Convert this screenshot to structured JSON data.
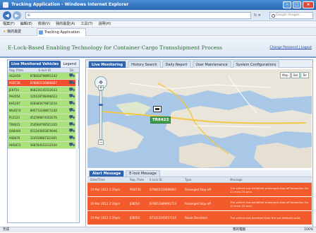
{
  "window": {
    "title": "Tracking Application - Windows Internet Explorer"
  },
  "addressbar": {
    "search_placeholder": "Google Images"
  },
  "menubar": {
    "items": [
      "檔案(F)",
      "編輯(E)",
      "檢視(V)",
      "我的最愛(A)",
      "工具(T)",
      "說明(H)"
    ]
  },
  "tabbar": {
    "favorites": "我的最愛",
    "tab_label": "Tracking Application"
  },
  "header": {
    "title": "E-Lock-Based Enabling Technology for Container Cargo Transshipment Process",
    "links": "Change Password | Logout"
  },
  "vehicles": {
    "tab": "Live Monitored Vehicles",
    "legend": "Legend",
    "columns": [
      "Reg. Plate",
      "E-lock ID",
      "Dir."
    ],
    "rows": [
      {
        "reg": "AG2458",
        "eid": "878658798991142",
        "alarm": false
      },
      {
        "reg": "PG6736",
        "eid": "878665156886667",
        "alarm": true
      },
      {
        "reg": "JE8754",
        "eid": "968236145552633",
        "alarm": false
      },
      {
        "reg": "PH2054",
        "eid": "120128798396623",
        "alarm": false
      },
      {
        "reg": "KH1207",
        "eid": "028385679873214",
        "alarm": false
      },
      {
        "reg": "WL8574",
        "eid": "895712348671230",
        "alarm": false
      },
      {
        "reg": "PL5123",
        "eid": "452596874163576",
        "alarm": false
      },
      {
        "reg": "TR8423",
        "eid": "254568798541320",
        "alarm": false
      },
      {
        "reg": "QA8448",
        "eid": "051245665879946",
        "alarm": false
      },
      {
        "reg": "AS8476",
        "eid": "124558987321401",
        "alarm": false
      },
      {
        "reg": "HH5873",
        "eid": "568784552132104",
        "alarm": false
      }
    ]
  },
  "tabs": [
    "Live Monitoring",
    "History Search",
    "Daily Report",
    "User Maintenance",
    "System Configurations"
  ],
  "map": {
    "marker": "TR8423",
    "types": [
      "Map",
      "Sat",
      "Ter"
    ]
  },
  "alerts": {
    "tabs": [
      "Alert Message",
      "E-lock Message"
    ],
    "columns": [
      "Date/Time",
      "Reg. Plate",
      "E-lock ID",
      "Type",
      "Message"
    ],
    "rows": [
      {
        "time": "19 Mar 2012 2:20pm",
        "reg": "PG6736",
        "eid": "878665156886667",
        "type": "Prolonged Stop-off",
        "msg": "The vehicle has exhibited prolonged stop-off behaviour for 12 mins 25 secs."
      },
      {
        "time": "19 Mar 2012 2:20pm",
        "reg": "JE8054",
        "eid": "878651989993713",
        "type": "Prolonged Stop-off",
        "msg": "The vehicle has exhibited prolonged stop-off behaviour for 10 mins 20 secs."
      },
      {
        "time": "19 Mar 2012 2:20pm",
        "reg": "JE8054",
        "eid": "872223245657145",
        "type": "Route Deviation",
        "msg": "The vehicle has deviated from the pre-defined route."
      }
    ]
  },
  "status": {
    "done": "完成",
    "zone": "我的電腦",
    "zoom": "100%"
  }
}
